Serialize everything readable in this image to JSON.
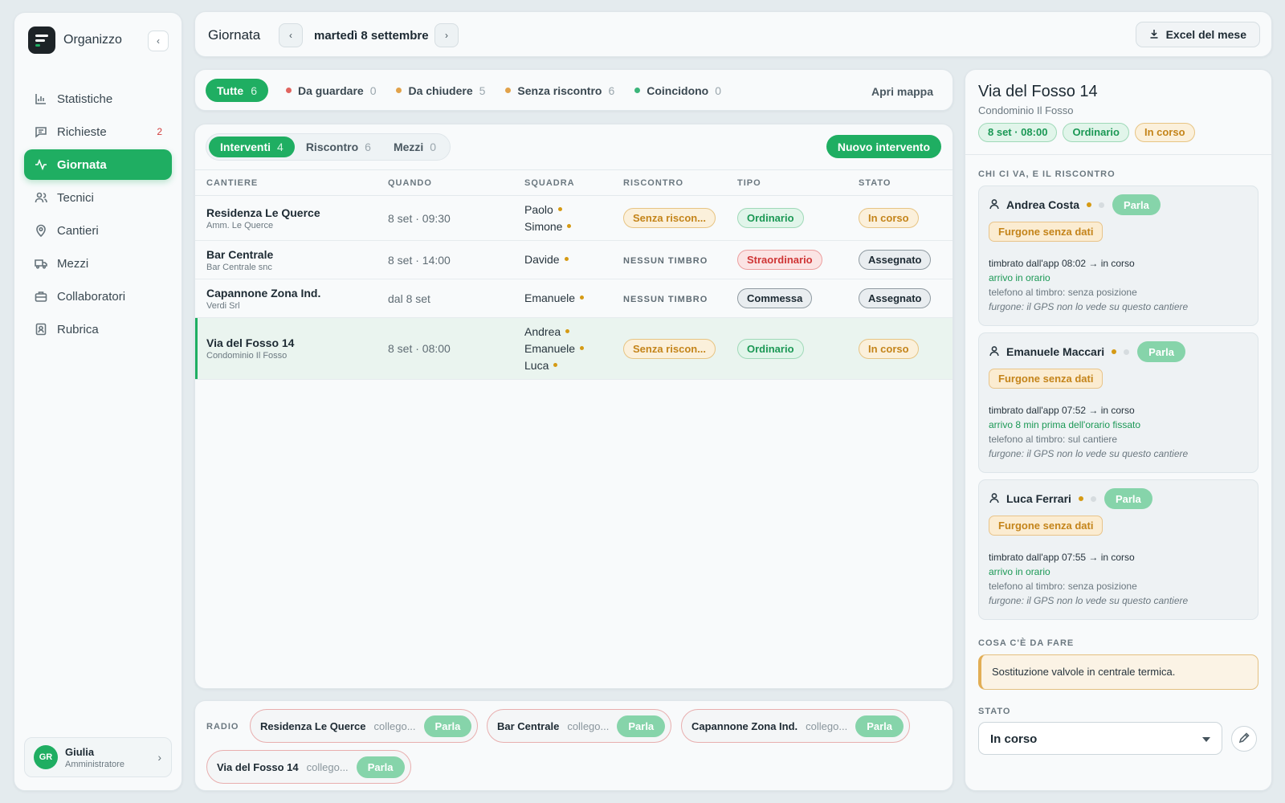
{
  "app": {
    "name": "Organizzo"
  },
  "sidebar": {
    "items": [
      {
        "label": "Statistiche",
        "icon": "bar-chart-icon"
      },
      {
        "label": "Richieste",
        "icon": "message-icon",
        "badge": "2"
      },
      {
        "label": "Giornata",
        "icon": "activity-icon",
        "active": true
      },
      {
        "label": "Tecnici",
        "icon": "users-icon"
      },
      {
        "label": "Cantieri",
        "icon": "map-pin-icon"
      },
      {
        "label": "Mezzi",
        "icon": "truck-icon"
      },
      {
        "label": "Collaboratori",
        "icon": "briefcase-icon"
      },
      {
        "label": "Rubrica",
        "icon": "contact-book-icon"
      }
    ],
    "user": {
      "initials": "GR",
      "name": "Giulia",
      "role": "Amministratore"
    }
  },
  "header": {
    "title": "Giornata",
    "date": "martedì 8 settembre",
    "excel_label": "Excel del mese"
  },
  "filters": {
    "all": {
      "label": "Tutte",
      "count": "6"
    },
    "items": [
      {
        "label": "Da guardare",
        "count": "0",
        "color": "#e0645f"
      },
      {
        "label": "Da chiudere",
        "count": "5",
        "color": "#e1a24a"
      },
      {
        "label": "Senza riscontro",
        "count": "6",
        "color": "#e1a24a"
      },
      {
        "label": "Coincidono",
        "count": "0",
        "color": "#3bb57a"
      }
    ],
    "map_label": "Apri mappa"
  },
  "main": {
    "tabs": [
      {
        "label": "Interventi",
        "count": "4"
      },
      {
        "label": "Riscontro",
        "count": "6"
      },
      {
        "label": "Mezzi",
        "count": "0"
      }
    ],
    "new_label": "Nuovo intervento",
    "columns": [
      "CANTIERE",
      "QUANDO",
      "SQUADRA",
      "RISCONTRO",
      "TIPO",
      "STATO"
    ],
    "rows": [
      {
        "site": "Residenza Le Querce",
        "client": "Amm. Le Querce",
        "when": "8 set · 09:30",
        "squad": [
          "Paolo",
          "Simone"
        ],
        "check": "Senza riscon...",
        "type": "Ordinario",
        "status": "In corso"
      },
      {
        "site": "Bar Centrale",
        "client": "Bar Centrale snc",
        "when": "8 set · 14:00",
        "squad": [
          "Davide"
        ],
        "check": "NESSUN TIMBRO",
        "type": "Straordinario",
        "status": "Assegnato"
      },
      {
        "site": "Capannone Zona Ind.",
        "client": "Verdi Srl",
        "when": "dal 8 set",
        "squad": [
          "Emanuele"
        ],
        "check": "NESSUN TIMBRO",
        "type": "Commessa",
        "status": "Assegnato"
      },
      {
        "site": "Via del Fosso 14",
        "client": "Condominio Il Fosso",
        "when": "8 set · 08:00",
        "squad": [
          "Andrea",
          "Emanuele",
          "Luca"
        ],
        "check": "Senza riscon...",
        "type": "Ordinario",
        "status": "In corso"
      }
    ]
  },
  "radio": {
    "label": "RADIO",
    "channels": [
      {
        "name": "Residenza Le Querce",
        "status": "collego...",
        "action": "Parla"
      },
      {
        "name": "Bar Centrale",
        "status": "collego...",
        "action": "Parla"
      },
      {
        "name": "Capannone Zona Ind.",
        "status": "collego...",
        "action": "Parla"
      },
      {
        "name": "Via del Fosso 14",
        "status": "collego...",
        "action": "Parla"
      }
    ]
  },
  "detail": {
    "title": "Via del Fosso 14",
    "subtitle": "Condominio Il Fosso",
    "tags": [
      "8 set · 08:00",
      "Ordinario",
      "In corso"
    ],
    "who_heading": "CHI CI VA, E IL RISCONTRO",
    "technicians": [
      {
        "name": "Andrea Costa",
        "action": "Parla",
        "van": "Furgone senza dati",
        "line1": "timbrato dall'app 08:02 → in corso",
        "line2": "arrivo in orario",
        "line3": "telefono al timbro: senza posizione",
        "line4": "furgone: il GPS non lo vede su questo cantiere"
      },
      {
        "name": "Emanuele Maccari",
        "action": "Parla",
        "van": "Furgone senza dati",
        "line1": "timbrato dall'app 07:52 → in corso",
        "line2": "arrivo 8 min prima dell'orario fissato",
        "line3": "telefono al timbro: sul cantiere",
        "line4": "furgone: il GPS non lo vede su questo cantiere"
      },
      {
        "name": "Luca Ferrari",
        "action": "Parla",
        "van": "Furgone senza dati",
        "line1": "timbrato dall'app 07:55 → in corso",
        "line2": "arrivo in orario",
        "line3": "telefono al timbro: senza posizione",
        "line4": "furgone: il GPS non lo vede su questo cantiere"
      }
    ],
    "todo_heading": "COSA C'È DA FARE",
    "todo": "Sostituzione valvole in centrale termica.",
    "status_heading": "STATO",
    "status_value": "In corso"
  }
}
